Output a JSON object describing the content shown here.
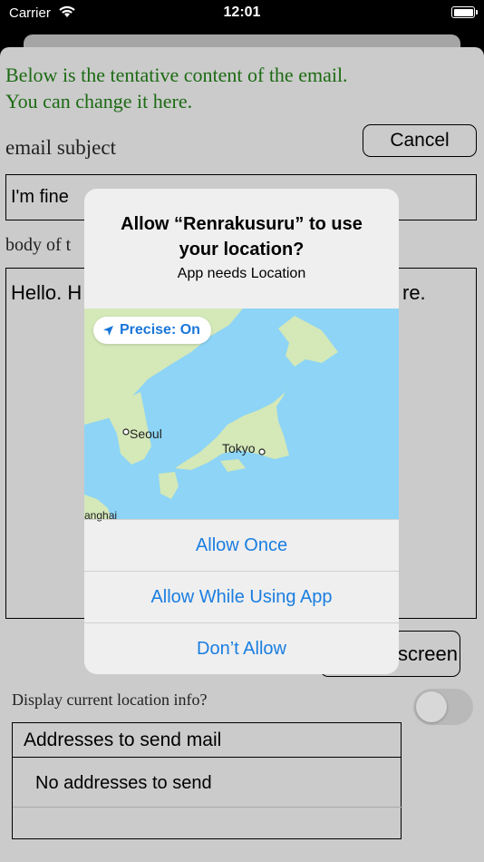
{
  "status_bar": {
    "carrier": "Carrier",
    "time": "12:01"
  },
  "form": {
    "intro": [
      "Below is the tentative content of the email.",
      "You can change it here."
    ],
    "subject_label": "email subject",
    "cancel_label": "Cancel",
    "subject_value": "I'm fine",
    "body_label": "body of t",
    "body_left": "Hello. H",
    "body_right": "re.",
    "screen_button_label": "screen",
    "location_label": "Display current location info?",
    "location_toggle_on": false
  },
  "addresses": {
    "header": "Addresses to send mail",
    "empty_text": "No addresses to send"
  },
  "alert": {
    "title_line1": "Allow “Renrakusuru” to use",
    "title_line2": "your location?",
    "message": "App needs Location",
    "precise_label": "Precise: On",
    "map_labels": {
      "seoul": "Seoul",
      "tokyo": "Tokyo",
      "shanghai": "anghai"
    },
    "buttons": [
      "Allow Once",
      "Allow While Using App",
      "Don’t Allow"
    ]
  },
  "colors": {
    "accent": "#1a7ee0",
    "intro_text": "#1c6a13",
    "sheet": "#cbcbcb",
    "sea": "#8dd4f6",
    "land": "#d4e8b8"
  }
}
